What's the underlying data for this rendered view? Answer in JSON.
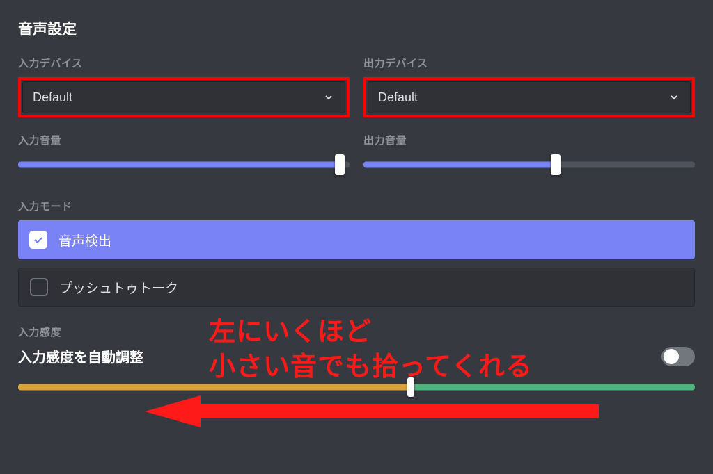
{
  "heading": "音声設定",
  "input_device": {
    "label": "入力デバイス",
    "value": "Default"
  },
  "output_device": {
    "label": "出力デバイス",
    "value": "Default"
  },
  "input_volume": {
    "label": "入力音量",
    "percent": 97
  },
  "output_volume": {
    "label": "出力音量",
    "percent": 58
  },
  "input_mode": {
    "label": "入力モード",
    "options": {
      "voice_activity": "音声検出",
      "push_to_talk": "プッシュトゥトーク"
    }
  },
  "sensitivity": {
    "label": "入力感度",
    "auto_label": "入力感度を自動調整",
    "auto_enabled": false,
    "threshold_percent": 58
  },
  "annotation": {
    "line1": "左にいくほど",
    "line2": "小さい音でも拾ってくれる"
  },
  "colors": {
    "accent": "#7983f5",
    "highlight_border": "#ff0000",
    "sens_low": "#d9a23a",
    "sens_high": "#4fb37d"
  }
}
